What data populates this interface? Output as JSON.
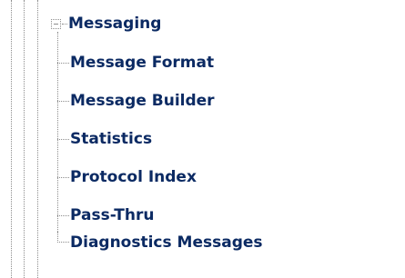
{
  "tree": {
    "parent": {
      "label": "Messaging",
      "expanded": true,
      "expander_icon": "minus-box-icon"
    },
    "children": [
      {
        "label": "Message Format"
      },
      {
        "label": "Message Builder"
      },
      {
        "label": "Statistics"
      },
      {
        "label": "Protocol Index"
      },
      {
        "label": "Pass-Thru"
      },
      {
        "label": "Diagnostics Messages"
      }
    ]
  },
  "colors": {
    "link_text": "#0b2a63",
    "guide_lines": "#8c8c8c",
    "background": "#ffffff"
  }
}
